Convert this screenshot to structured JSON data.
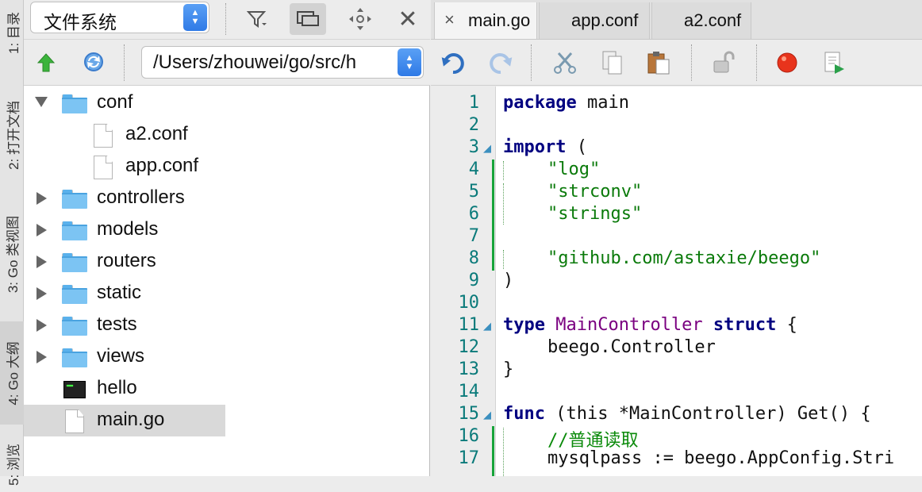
{
  "dock": {
    "tabs": [
      {
        "label": "1: 目录"
      },
      {
        "label": "2: 打开文档"
      },
      {
        "label": "3: Go 类视图"
      },
      {
        "label": "4: Go 大纲"
      },
      {
        "label": "5: 浏览"
      }
    ]
  },
  "sidebar": {
    "view_combo": "文件系统",
    "path": "/Users/zhouwei/go/src/h",
    "tree": [
      {
        "label": "conf",
        "kind": "folder",
        "state": "expanded"
      },
      {
        "label": "a2.conf",
        "kind": "file"
      },
      {
        "label": "app.conf",
        "kind": "file"
      },
      {
        "label": "controllers",
        "kind": "folder",
        "state": "collapsed"
      },
      {
        "label": "models",
        "kind": "folder",
        "state": "collapsed"
      },
      {
        "label": "routers",
        "kind": "folder",
        "state": "collapsed"
      },
      {
        "label": "static",
        "kind": "folder",
        "state": "collapsed"
      },
      {
        "label": "tests",
        "kind": "folder",
        "state": "collapsed"
      },
      {
        "label": "views",
        "kind": "folder",
        "state": "collapsed"
      },
      {
        "label": "hello",
        "kind": "executable"
      },
      {
        "label": "main.go",
        "kind": "file",
        "selected": true
      }
    ]
  },
  "editor": {
    "tabs": [
      {
        "label": "main.go",
        "active": true,
        "close": "×"
      },
      {
        "label": "app.conf"
      },
      {
        "label": "a2.conf"
      }
    ],
    "line_numbers": [
      "1",
      "2",
      "3",
      "4",
      "5",
      "6",
      "7",
      "8",
      "9",
      "10",
      "11",
      "12",
      "13",
      "14",
      "15",
      "16",
      "17"
    ],
    "code": {
      "l1_kw": "package",
      "l1_rest": " main",
      "l3_kw": "import",
      "l3_rest": " (",
      "l4": "\"log\"",
      "l5": "\"strconv\"",
      "l6": "\"strings\"",
      "l8": "\"github.com/astaxie/beego\"",
      "l9": ")",
      "l11_kw": "type",
      "l11_name": "MainController",
      "l11_kw2": "struct",
      "l11_rest": " {",
      "l12": "beego.Controller",
      "l13": "}",
      "l15_kw": "func",
      "l15_rest": " (this *MainController) Get() {",
      "l16": "//普通读取",
      "l17": "mysqlpass := beego.AppConfig.Stri"
    }
  },
  "colors": {
    "keyword": "#000080",
    "string": "#0a7a0a",
    "type_name": "#7a0080",
    "line_number": "#0a7a7a",
    "change_bar": "#17a43a"
  }
}
